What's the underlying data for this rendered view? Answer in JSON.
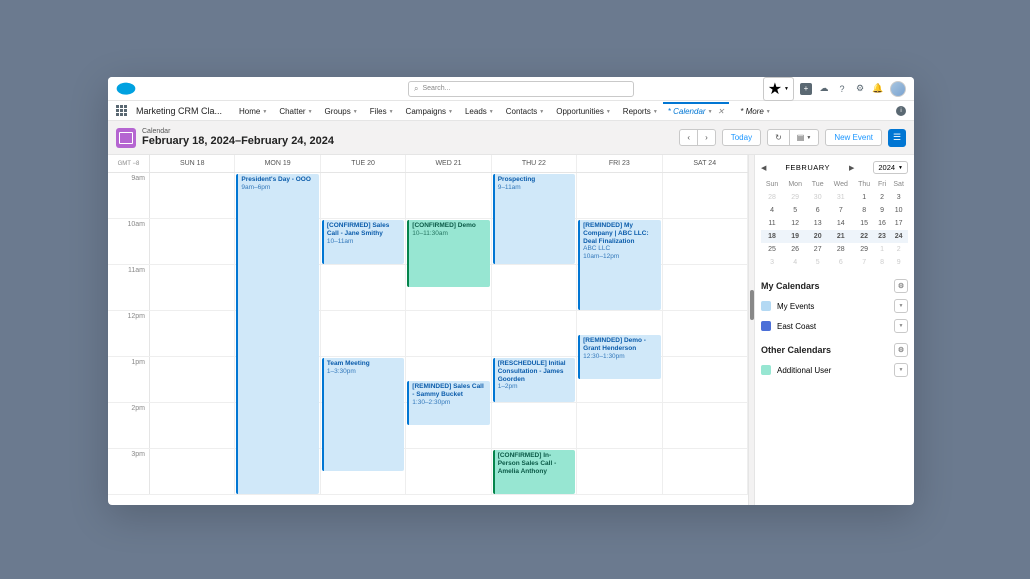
{
  "header": {
    "search_placeholder": "Search...",
    "app_name": "Marketing CRM Cla...",
    "nav": [
      "Home",
      "Chatter",
      "Groups",
      "Files",
      "Campaigns",
      "Leads",
      "Contacts",
      "Opportunities",
      "Reports"
    ],
    "nav_active": "* Calendar",
    "nav_more": "* More"
  },
  "toolbar": {
    "subtitle": "Calendar",
    "title": "February 18, 2024–February 24, 2024",
    "today": "Today",
    "new_event": "New Event"
  },
  "grid": {
    "tz": "GMT −8",
    "days": [
      "SUN 18",
      "MON 19",
      "TUE 20",
      "WED 21",
      "THU 22",
      "FRI 23",
      "SAT 24"
    ],
    "hours": [
      "9am",
      "10am",
      "11am",
      "12pm",
      "1pm",
      "2pm",
      "3pm"
    ]
  },
  "events": [
    {
      "title": "President's Day - OOO",
      "time": "9am–6pm",
      "col": 1,
      "start": 0,
      "dur": 7,
      "cls": "ev-blue"
    },
    {
      "title": "[CONFIRMED] Sales Call - Jane Smithy",
      "time": "10–11am",
      "col": 2,
      "start": 1,
      "dur": 1,
      "cls": "ev-blue"
    },
    {
      "title": "Team Meeting",
      "time": "1–3:30pm",
      "col": 2,
      "start": 4,
      "dur": 2.5,
      "cls": "ev-blue"
    },
    {
      "title": "[CONFIRMED] Demo",
      "time": "10–11:30am",
      "col": 3,
      "start": 1,
      "dur": 1.5,
      "cls": "ev-green"
    },
    {
      "title": "[REMINDED] Sales Call - Sammy Bucket",
      "time": "1:30–2:30pm",
      "col": 3,
      "start": 4.5,
      "dur": 1,
      "cls": "ev-blue"
    },
    {
      "title": "Prospecting",
      "time": "9–11am",
      "col": 4,
      "start": 0,
      "dur": 2,
      "cls": "ev-blue"
    },
    {
      "title": "[RESCHEDULE] Initial Consultation - James Goorden",
      "time": "1–2pm",
      "col": 4,
      "start": 4,
      "dur": 1,
      "cls": "ev-blue"
    },
    {
      "title": "[CONFIRMED] In-Person Sales Call - Amelia Anthony",
      "time": "",
      "col": 4,
      "start": 6,
      "dur": 1,
      "cls": "ev-green"
    },
    {
      "title": "[REMINDED] My Company | ABC LLC: Deal Finalization",
      "sub": "ABC LLC",
      "time": "10am–12pm",
      "col": 5,
      "start": 1,
      "dur": 2,
      "cls": "ev-blue"
    },
    {
      "title": "[REMINDED] Demo - Grant Henderson",
      "time": "12:30–1:30pm",
      "col": 5,
      "start": 3.5,
      "dur": 1,
      "cls": "ev-blue"
    }
  ],
  "mini": {
    "month": "FEBRUARY",
    "year": "2024",
    "dow": [
      "Sun",
      "Mon",
      "Tue",
      "Wed",
      "Thu",
      "Fri",
      "Sat"
    ],
    "weeks": [
      [
        {
          "d": "28",
          "o": 1
        },
        {
          "d": "29",
          "o": 1
        },
        {
          "d": "30",
          "o": 1
        },
        {
          "d": "31",
          "o": 1
        },
        {
          "d": "1"
        },
        {
          "d": "2"
        },
        {
          "d": "3"
        }
      ],
      [
        {
          "d": "4"
        },
        {
          "d": "5"
        },
        {
          "d": "6"
        },
        {
          "d": "7"
        },
        {
          "d": "8"
        },
        {
          "d": "9"
        },
        {
          "d": "10"
        }
      ],
      [
        {
          "d": "11"
        },
        {
          "d": "12"
        },
        {
          "d": "13"
        },
        {
          "d": "14"
        },
        {
          "d": "15"
        },
        {
          "d": "16"
        },
        {
          "d": "17"
        }
      ],
      [
        {
          "d": "18",
          "c": 1
        },
        {
          "d": "19",
          "c": 1
        },
        {
          "d": "20",
          "c": 1
        },
        {
          "d": "21",
          "c": 1
        },
        {
          "d": "22",
          "c": 1
        },
        {
          "d": "23",
          "c": 1
        },
        {
          "d": "24",
          "c": 1
        }
      ],
      [
        {
          "d": "25"
        },
        {
          "d": "26"
        },
        {
          "d": "27"
        },
        {
          "d": "28"
        },
        {
          "d": "29"
        },
        {
          "d": "1",
          "o": 1
        },
        {
          "d": "2",
          "o": 1
        }
      ],
      [
        {
          "d": "3",
          "o": 1
        },
        {
          "d": "4",
          "o": 1
        },
        {
          "d": "5",
          "o": 1
        },
        {
          "d": "6",
          "o": 1
        },
        {
          "d": "7",
          "o": 1
        },
        {
          "d": "8",
          "o": 1
        },
        {
          "d": "9",
          "o": 1
        }
      ]
    ]
  },
  "sidebar": {
    "my_calendars": "My Calendars",
    "other_calendars": "Other Calendars",
    "cals": {
      "my_events": "My Events",
      "east_coast": "East Coast",
      "additional": "Additional User"
    }
  }
}
